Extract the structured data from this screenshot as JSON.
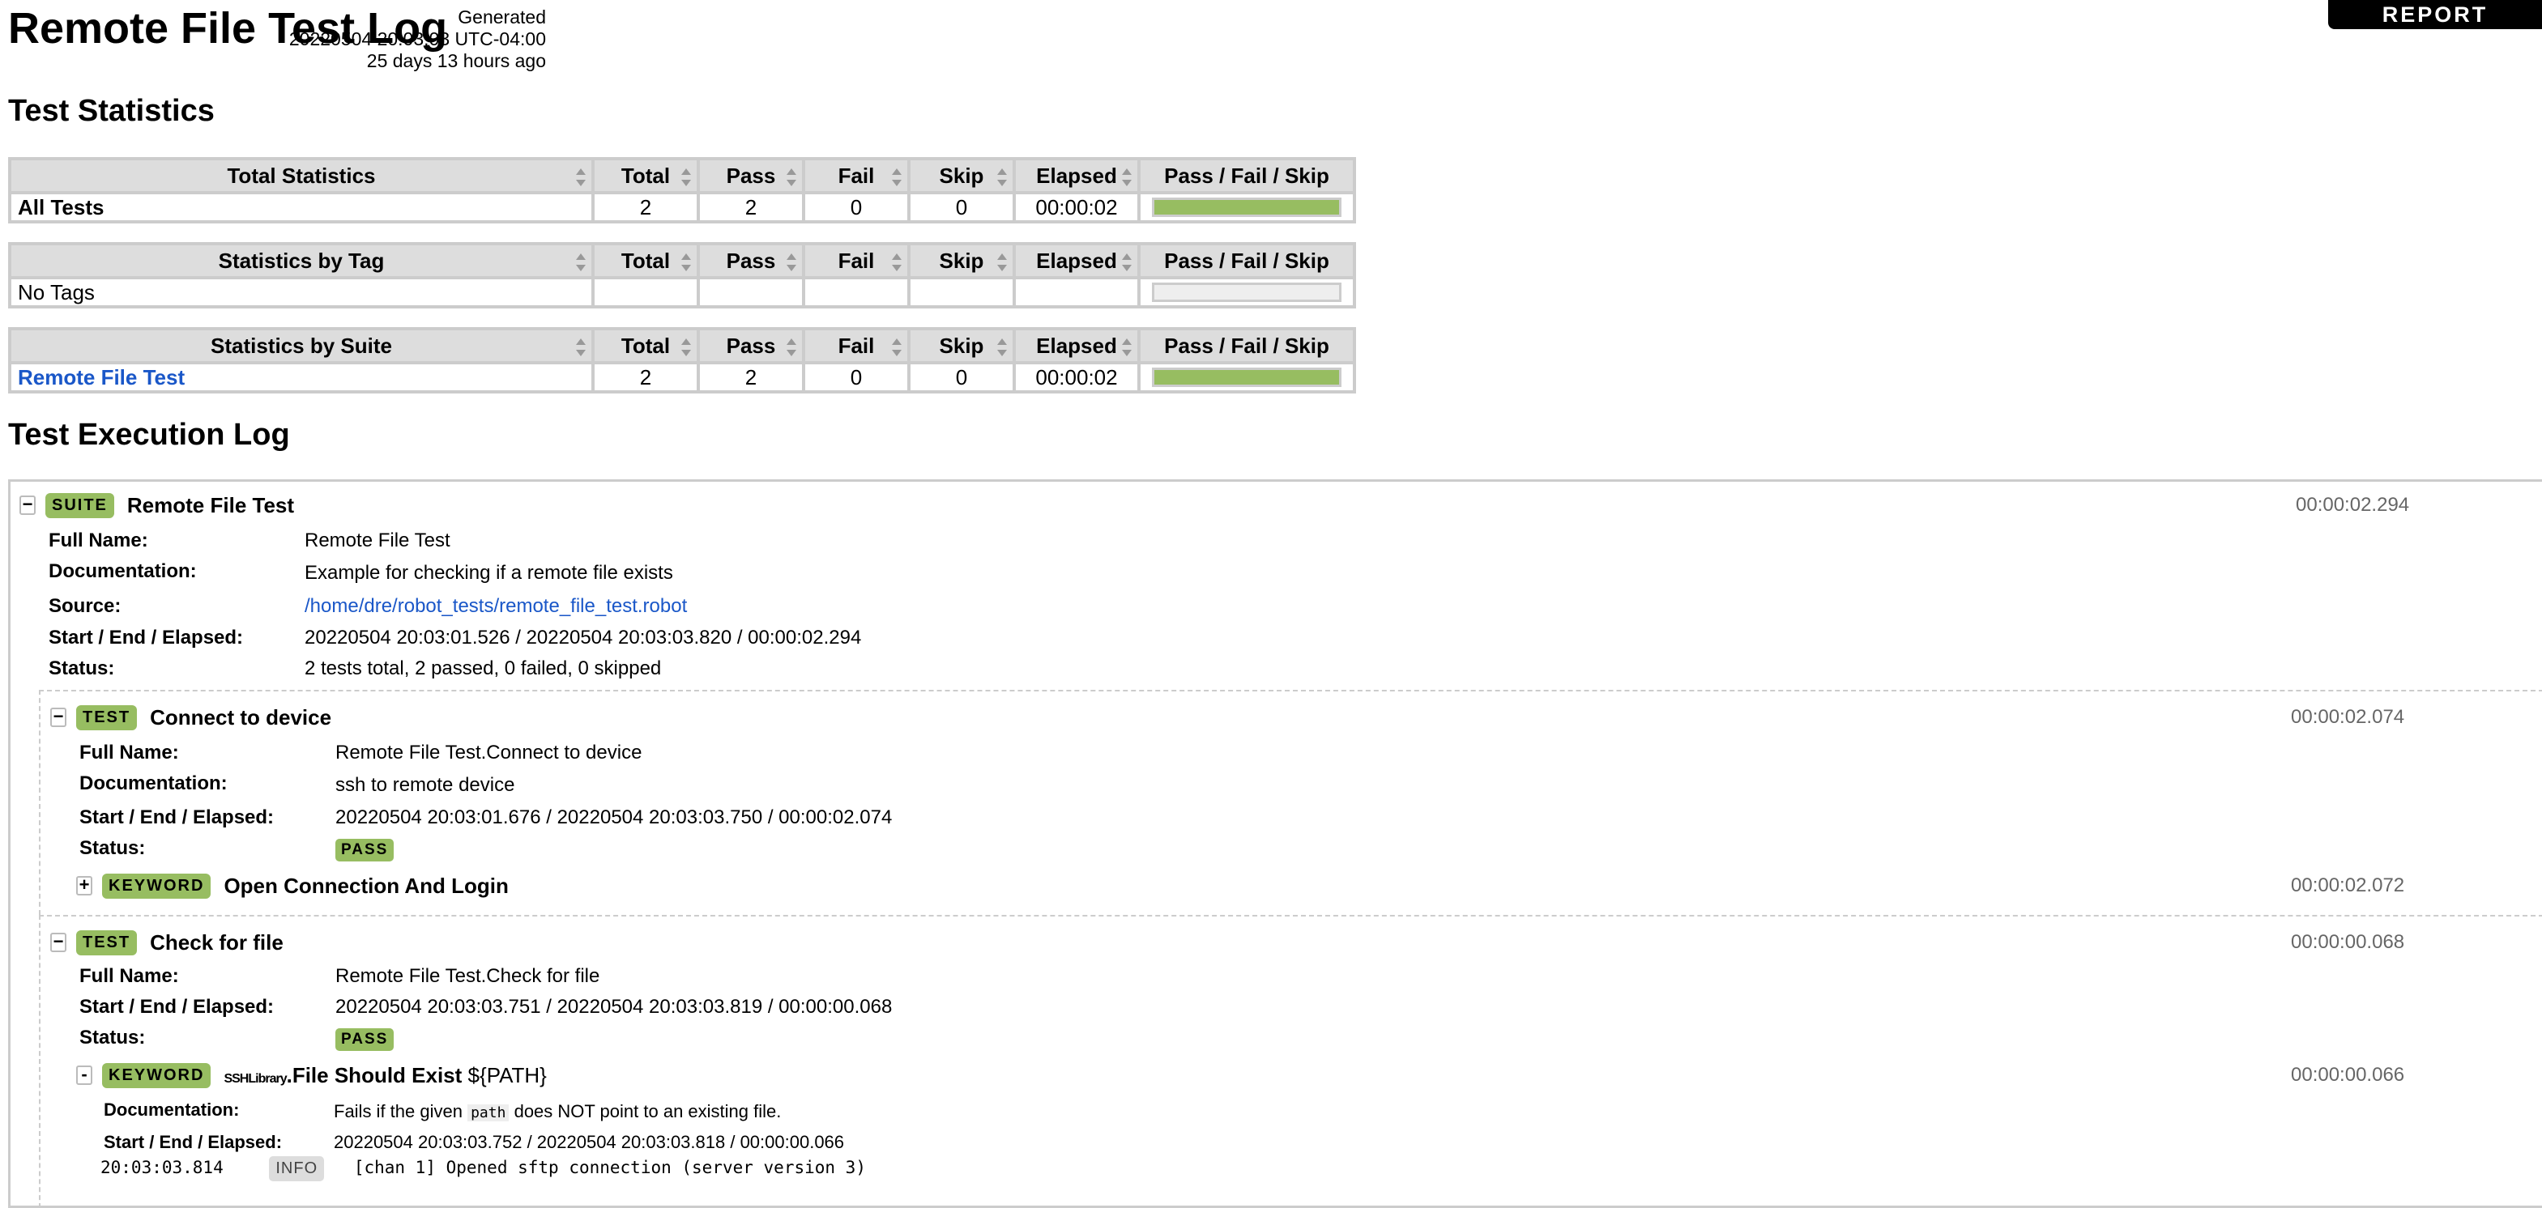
{
  "header": {
    "title": "Remote File Test Log",
    "generated_label": "Generated",
    "generated_timestamp": "20220504 20:03:03 UTC-04:00",
    "generated_ago": "25 days 13 hours ago",
    "report_link": "REPORT"
  },
  "statistics": {
    "heading": "Test Statistics",
    "columns": [
      "Total",
      "Pass",
      "Fail",
      "Skip",
      "Elapsed",
      "Pass / Fail / Skip"
    ],
    "tables": [
      {
        "title": "Total Statistics",
        "rows": [
          {
            "name": "All Tests",
            "total": "2",
            "pass": "2",
            "fail": "0",
            "skip": "0",
            "elapsed": "00:00:02",
            "pass_ratio": 1.0
          }
        ]
      },
      {
        "title": "Statistics by Tag",
        "rows": [
          {
            "name": "No Tags",
            "total": "",
            "pass": "",
            "fail": "",
            "skip": "",
            "elapsed": "",
            "pass_ratio": 0
          }
        ]
      },
      {
        "title": "Statistics by Suite",
        "rows": [
          {
            "name": "Remote File Test",
            "total": "2",
            "pass": "2",
            "fail": "0",
            "skip": "0",
            "elapsed": "00:00:02",
            "pass_ratio": 1.0
          }
        ]
      }
    ]
  },
  "log": {
    "heading": "Test Execution Log",
    "suite": {
      "label": "SUITE",
      "name": "Remote File Test",
      "elapsed": "00:00:02.294",
      "meta": {
        "full_name_label": "Full Name:",
        "full_name": "Remote File Test",
        "doc_label": "Documentation:",
        "doc": "Example for checking if a remote file exists",
        "source_label": "Source:",
        "source": "/home/dre/robot_tests/remote_file_test.robot",
        "times_label": "Start / End / Elapsed:",
        "times": "20220504 20:03:01.526 / 20220504 20:03:03.820 / 00:00:02.294",
        "status_label": "Status:",
        "status": "2 tests total, 2 passed, 0 failed, 0 skipped"
      }
    },
    "tests": [
      {
        "label": "TEST",
        "name": "Connect to device",
        "elapsed": "00:00:02.074",
        "full_name_label": "Full Name:",
        "full_name": "Remote File Test.Connect to device",
        "doc_label": "Documentation:",
        "doc": "ssh to remote device",
        "times_label": "Start / End / Elapsed:",
        "times": "20220504 20:03:01.676 / 20220504 20:03:03.750 / 00:00:02.074",
        "status_label": "Status:",
        "status": "PASS",
        "keyword": {
          "toggle": "+",
          "label": "KEYWORD",
          "name": "Open Connection And Login",
          "elapsed": "00:00:02.072"
        }
      },
      {
        "label": "TEST",
        "name": "Check for file",
        "elapsed": "00:00:00.068",
        "full_name_label": "Full Name:",
        "full_name": "Remote File Test.Check for file",
        "times_label": "Start / End / Elapsed:",
        "times": "20220504 20:03:03.751 / 20220504 20:03:03.819 / 00:00:00.068",
        "status_label": "Status:",
        "status": "PASS",
        "keyword": {
          "toggle": "-",
          "label": "KEYWORD",
          "library": "SSHLibrary",
          "separator": ".",
          "name": "File Should Exist",
          "args": "${PATH}",
          "elapsed": "00:00:00.066",
          "doc_label": "Documentation:",
          "doc_pre": "Fails if the given",
          "doc_code": "path",
          "doc_post": "does NOT point to an existing file.",
          "times_label": "Start / End / Elapsed:",
          "times": "20220504 20:03:03.752 / 20220504 20:03:03.818 / 00:00:00.066",
          "message": {
            "timestamp": "20:03:03.814",
            "level": "INFO",
            "text": "[chan 1] Opened sftp connection (server version 3)"
          }
        }
      }
    ]
  }
}
